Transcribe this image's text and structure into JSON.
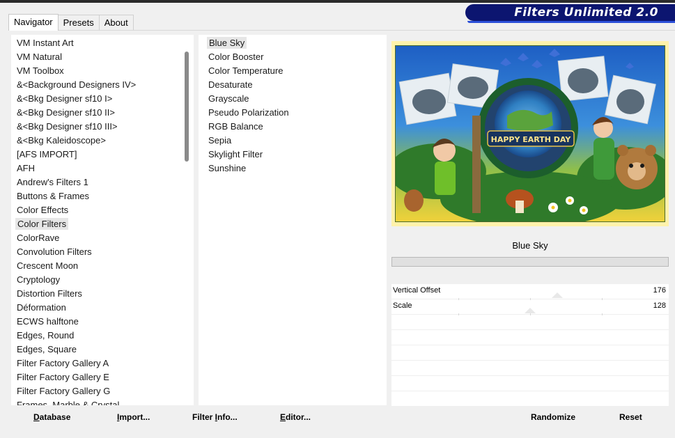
{
  "app": {
    "brand_title": "Filters Unlimited 2.0"
  },
  "tabs": [
    {
      "label": "Navigator",
      "active": true
    },
    {
      "label": "Presets",
      "active": false
    },
    {
      "label": "About",
      "active": false
    }
  ],
  "categories": {
    "selected": "Color Filters",
    "items": [
      "VM Instant Art",
      "VM Natural",
      "VM Toolbox",
      "&<Background Designers IV>",
      "&<Bkg Designer sf10 I>",
      "&<Bkg Designer sf10 II>",
      "&<Bkg Designer sf10 III>",
      "&<Bkg Kaleidoscope>",
      "[AFS IMPORT]",
      "AFH",
      "Andrew's Filters 1",
      "Buttons & Frames",
      "Color Effects",
      "Color Filters",
      "ColorRave",
      "Convolution Filters",
      "Crescent Moon",
      "Cryptology",
      "Distortion Filters",
      "Déformation",
      "ECWS halftone",
      "Edges, Round",
      "Edges, Square",
      "Filter Factory Gallery A",
      "Filter Factory Gallery E",
      "Filter Factory Gallery G",
      "Frames, Marble & Crystal"
    ]
  },
  "filters": {
    "selected": "Blue Sky",
    "items": [
      "Blue Sky",
      "Color Booster",
      "Color Temperature",
      "Desaturate",
      "Grayscale",
      "Pseudo Polarization",
      "RGB Balance",
      "Sepia",
      "Skylight Filter",
      "Sunshine"
    ]
  },
  "preview": {
    "banner_text": "HAPPY EARTH DAY",
    "filter_name": "Blue Sky"
  },
  "params": [
    {
      "name": "Vertical Offset",
      "value": "176",
      "level": 0.69
    },
    {
      "name": "Scale",
      "value": "128",
      "level": 0.5
    }
  ],
  "buttons": {
    "database": {
      "u": "D",
      "rest": "atabase"
    },
    "import": {
      "u": "I",
      "rest": "mport..."
    },
    "filter_info": {
      "pre": "Filter ",
      "u": "I",
      "rest": "nfo..."
    },
    "editor": {
      "u": "E",
      "rest": "ditor..."
    },
    "randomize": "Randomize",
    "reset": "Reset"
  },
  "colors": {
    "brand_bg": "#0c1570",
    "accent": "#2b4fd8",
    "preview_border": "#fff2ab"
  }
}
